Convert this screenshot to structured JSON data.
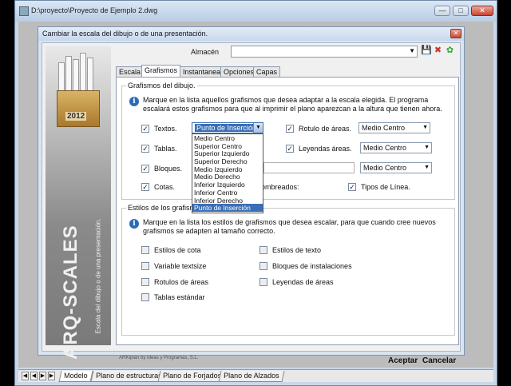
{
  "window": {
    "title": "D:\\proyecto\\Proyecto de Ejemplo 2.dwg"
  },
  "dialog": {
    "title": "Cambiar la escala del dibujo o de una presentación.",
    "almacen_label": "Almacén",
    "almacen_value": "",
    "banner_title": "ARQ-SCALES",
    "banner_subtitle": "Escala del dibujo o de una presentación.",
    "year": "2012",
    "tabs": [
      "Escala",
      "Grafismos",
      "Instantaneas",
      "Opciones",
      "Capas"
    ],
    "group1": {
      "label": "Grafismos del dibujo.",
      "desc": "Marque en la lista aquellos grafismos que desea adaptar a la escala elegida. El programa escalará estos grafismos para que al imprimir el plano aparezcan a la altura que tienen ahora.",
      "textos": {
        "label": "Textos.",
        "value": "Punto de Inserción"
      },
      "tablas": {
        "label": "Tablas."
      },
      "bloques": {
        "label": "Bloques."
      },
      "cotas": {
        "label": "Cotas."
      },
      "sombreados": {
        "label": "Sombreados:"
      },
      "rotulo": {
        "label": "Rotulo de áreas.",
        "value": "Medio Centro"
      },
      "leyendas": {
        "label": "Leyendas áreas.",
        "value": "Medio Centro"
      },
      "bloques_combo": "Medio Centro",
      "tipos_linea": {
        "label": "Tipos de Línea."
      }
    },
    "dropdown_options": [
      "Medio Centro",
      "Superior Centro",
      "Superior Izquierdo",
      "Superior Derecho",
      "Medio Izquierdo",
      "Medio Derecho",
      "Inferior Izquierdo",
      "Inferior Centro",
      "Inferior Derecho",
      "Punto de Inserción"
    ],
    "group2": {
      "label": "Estilos de los grafismos",
      "desc": "Marque en la lista los estilos de grafismos que desea escalar, para que cuando cree nuevos grafismos se adapten al tamaño correcto.",
      "items": [
        "Estilos de cota",
        "Variable textsize",
        "Rotulos de áreas",
        "Tablas estándar",
        "Estilos de texto",
        "Bloques de instalaciones",
        "Leyendas de áreas"
      ]
    },
    "footer_note": "ARKIplan by Ideas y Programas, S.L.",
    "accept": "Aceptar",
    "cancel": "Cancelar"
  },
  "layout_tabs": [
    "Modelo",
    "Plano de estructuras",
    "Plano de Forjados",
    "Plano de Alzados"
  ]
}
